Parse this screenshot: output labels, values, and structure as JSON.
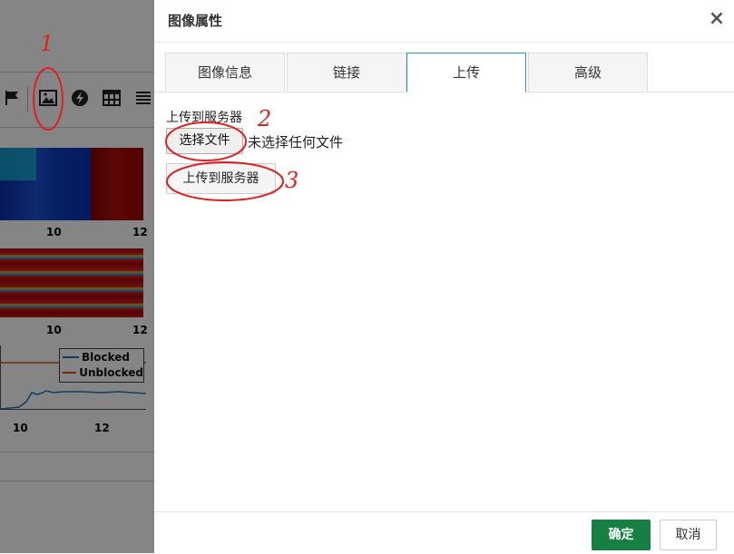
{
  "background": {
    "toolbar_icons": [
      "flag-icon",
      "image-icon",
      "flash-icon",
      "table-icon",
      "align-icon"
    ],
    "heatmap_ticks": [
      "10",
      "12"
    ],
    "heatmap2_ticks": [
      "10",
      "12"
    ],
    "lineplot_ticks": [
      "10",
      "12"
    ],
    "legend": [
      {
        "label": "Blocked",
        "color": "#1f77b4"
      },
      {
        "label": "Unblocked",
        "color": "#d95319"
      }
    ]
  },
  "dialog": {
    "title": "图像属性",
    "close_symbol": "×",
    "tabs": [
      {
        "label": "图像信息",
        "active": false
      },
      {
        "label": "链接",
        "active": false
      },
      {
        "label": "上传",
        "active": true
      },
      {
        "label": "高级",
        "active": false
      }
    ],
    "upload": {
      "label": "上传到服务器",
      "choose_file_button": "选择文件",
      "file_status": "未选择任何文件",
      "upload_button": "上传到服务器"
    },
    "footer": {
      "ok_button": "确定",
      "cancel_button": "取消"
    }
  },
  "annotations": [
    "1",
    "2",
    "3"
  ],
  "colors": {
    "accent_tab_border": "#2196d8",
    "ok_button": "#168043",
    "annotation": "#e02020"
  }
}
